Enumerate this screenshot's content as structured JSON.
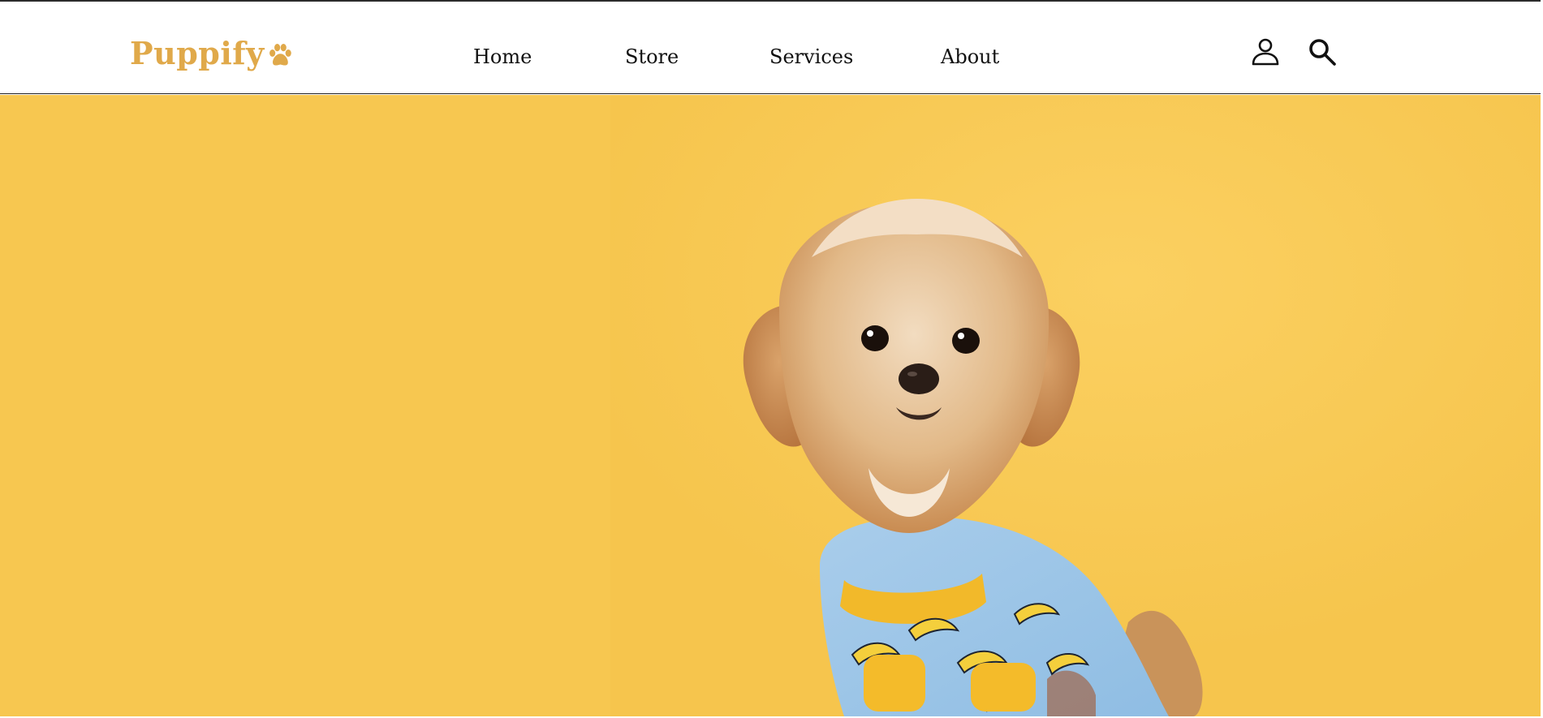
{
  "brand": {
    "name": "Puppify",
    "color": "#e0a94a",
    "logo_icon": "paw-icon"
  },
  "nav": {
    "items": [
      {
        "label": "Home"
      },
      {
        "label": "Store"
      },
      {
        "label": "Services"
      },
      {
        "label": "About"
      }
    ]
  },
  "header_icons": {
    "account": "user-icon",
    "search": "search-icon"
  },
  "hero": {
    "background_color": "#f7c750",
    "image_subject": "dog-photo"
  }
}
